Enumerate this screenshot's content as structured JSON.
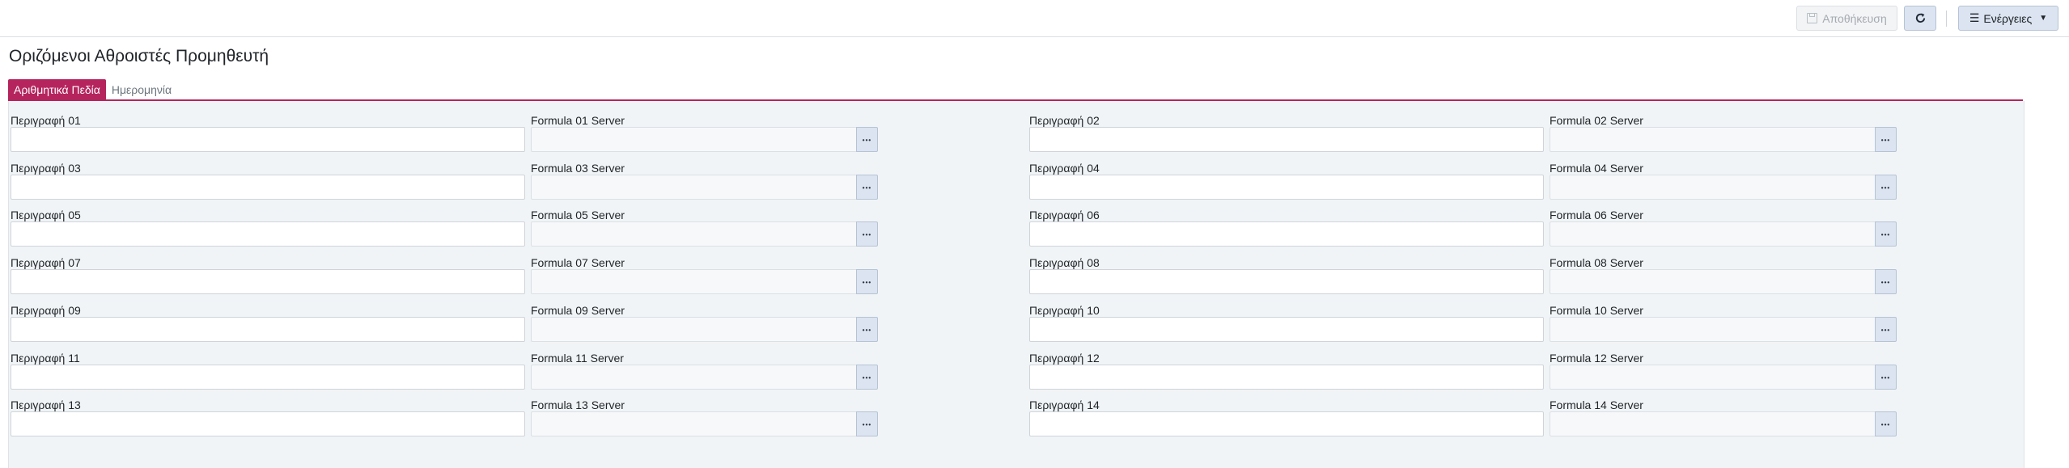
{
  "toolbar": {
    "save_label": "Αποθήκευση",
    "actions_label": "Ενέργειες",
    "save_icon": "floppy-disk-icon",
    "refresh_icon": "refresh-icon",
    "actions_icon": "bars-icon",
    "caret_icon": "caret-down-icon"
  },
  "page": {
    "title": "Οριζόμενοι Αθροιστές Προμηθευτή"
  },
  "tabs": [
    {
      "label": "Αριθμητικά Πεδία",
      "active": true
    },
    {
      "label": "Ημερομηνία",
      "active": false
    }
  ],
  "colors": {
    "accent": "#b5245d",
    "button_bg": "#dbe4f0",
    "panel_bg": "#f1f4f6"
  },
  "fields": [
    {
      "desc_label": "Περιγραφή 01",
      "desc_value": "",
      "formula_label": "Formula 01 Server",
      "formula_value": ""
    },
    {
      "desc_label": "Περιγραφή 02",
      "desc_value": "",
      "formula_label": "Formula 02 Server",
      "formula_value": ""
    },
    {
      "desc_label": "Περιγραφή 03",
      "desc_value": "",
      "formula_label": "Formula 03 Server",
      "formula_value": ""
    },
    {
      "desc_label": "Περιγραφή 04",
      "desc_value": "",
      "formula_label": "Formula 04 Server",
      "formula_value": ""
    },
    {
      "desc_label": "Περιγραφή 05",
      "desc_value": "",
      "formula_label": "Formula 05 Server",
      "formula_value": ""
    },
    {
      "desc_label": "Περιγραφή 06",
      "desc_value": "",
      "formula_label": "Formula 06 Server",
      "formula_value": ""
    },
    {
      "desc_label": "Περιγραφή 07",
      "desc_value": "",
      "formula_label": "Formula 07 Server",
      "formula_value": ""
    },
    {
      "desc_label": "Περιγραφή 08",
      "desc_value": "",
      "formula_label": "Formula 08 Server",
      "formula_value": ""
    },
    {
      "desc_label": "Περιγραφή 09",
      "desc_value": "",
      "formula_label": "Formula 09 Server",
      "formula_value": ""
    },
    {
      "desc_label": "Περιγραφή 10",
      "desc_value": "",
      "formula_label": "Formula 10 Server",
      "formula_value": ""
    },
    {
      "desc_label": "Περιγραφή 11",
      "desc_value": "",
      "formula_label": "Formula 11 Server",
      "formula_value": ""
    },
    {
      "desc_label": "Περιγραφή 12",
      "desc_value": "",
      "formula_label": "Formula 12 Server",
      "formula_value": ""
    },
    {
      "desc_label": "Περιγραφή 13",
      "desc_value": "",
      "formula_label": "Formula 13 Server",
      "formula_value": ""
    },
    {
      "desc_label": "Περιγραφή 14",
      "desc_value": "",
      "formula_label": "Formula 14 Server",
      "formula_value": ""
    }
  ]
}
